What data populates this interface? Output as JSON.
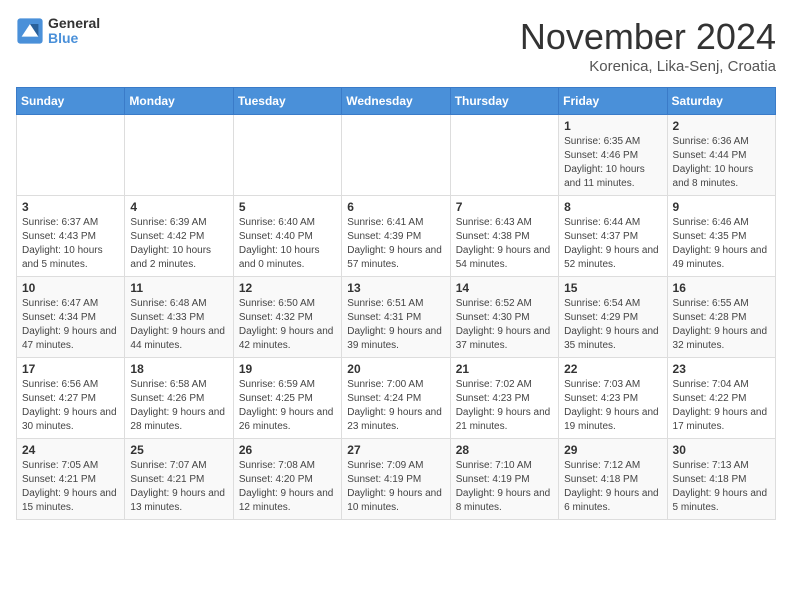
{
  "logo": {
    "text_general": "General",
    "text_blue": "Blue"
  },
  "title": "November 2024",
  "subtitle": "Korenica, Lika-Senj, Croatia",
  "days_of_week": [
    "Sunday",
    "Monday",
    "Tuesday",
    "Wednesday",
    "Thursday",
    "Friday",
    "Saturday"
  ],
  "weeks": [
    [
      {
        "day": "",
        "info": ""
      },
      {
        "day": "",
        "info": ""
      },
      {
        "day": "",
        "info": ""
      },
      {
        "day": "",
        "info": ""
      },
      {
        "day": "",
        "info": ""
      },
      {
        "day": "1",
        "info": "Sunrise: 6:35 AM\nSunset: 4:46 PM\nDaylight: 10 hours and 11 minutes."
      },
      {
        "day": "2",
        "info": "Sunrise: 6:36 AM\nSunset: 4:44 PM\nDaylight: 10 hours and 8 minutes."
      }
    ],
    [
      {
        "day": "3",
        "info": "Sunrise: 6:37 AM\nSunset: 4:43 PM\nDaylight: 10 hours and 5 minutes."
      },
      {
        "day": "4",
        "info": "Sunrise: 6:39 AM\nSunset: 4:42 PM\nDaylight: 10 hours and 2 minutes."
      },
      {
        "day": "5",
        "info": "Sunrise: 6:40 AM\nSunset: 4:40 PM\nDaylight: 10 hours and 0 minutes."
      },
      {
        "day": "6",
        "info": "Sunrise: 6:41 AM\nSunset: 4:39 PM\nDaylight: 9 hours and 57 minutes."
      },
      {
        "day": "7",
        "info": "Sunrise: 6:43 AM\nSunset: 4:38 PM\nDaylight: 9 hours and 54 minutes."
      },
      {
        "day": "8",
        "info": "Sunrise: 6:44 AM\nSunset: 4:37 PM\nDaylight: 9 hours and 52 minutes."
      },
      {
        "day": "9",
        "info": "Sunrise: 6:46 AM\nSunset: 4:35 PM\nDaylight: 9 hours and 49 minutes."
      }
    ],
    [
      {
        "day": "10",
        "info": "Sunrise: 6:47 AM\nSunset: 4:34 PM\nDaylight: 9 hours and 47 minutes."
      },
      {
        "day": "11",
        "info": "Sunrise: 6:48 AM\nSunset: 4:33 PM\nDaylight: 9 hours and 44 minutes."
      },
      {
        "day": "12",
        "info": "Sunrise: 6:50 AM\nSunset: 4:32 PM\nDaylight: 9 hours and 42 minutes."
      },
      {
        "day": "13",
        "info": "Sunrise: 6:51 AM\nSunset: 4:31 PM\nDaylight: 9 hours and 39 minutes."
      },
      {
        "day": "14",
        "info": "Sunrise: 6:52 AM\nSunset: 4:30 PM\nDaylight: 9 hours and 37 minutes."
      },
      {
        "day": "15",
        "info": "Sunrise: 6:54 AM\nSunset: 4:29 PM\nDaylight: 9 hours and 35 minutes."
      },
      {
        "day": "16",
        "info": "Sunrise: 6:55 AM\nSunset: 4:28 PM\nDaylight: 9 hours and 32 minutes."
      }
    ],
    [
      {
        "day": "17",
        "info": "Sunrise: 6:56 AM\nSunset: 4:27 PM\nDaylight: 9 hours and 30 minutes."
      },
      {
        "day": "18",
        "info": "Sunrise: 6:58 AM\nSunset: 4:26 PM\nDaylight: 9 hours and 28 minutes."
      },
      {
        "day": "19",
        "info": "Sunrise: 6:59 AM\nSunset: 4:25 PM\nDaylight: 9 hours and 26 minutes."
      },
      {
        "day": "20",
        "info": "Sunrise: 7:00 AM\nSunset: 4:24 PM\nDaylight: 9 hours and 23 minutes."
      },
      {
        "day": "21",
        "info": "Sunrise: 7:02 AM\nSunset: 4:23 PM\nDaylight: 9 hours and 21 minutes."
      },
      {
        "day": "22",
        "info": "Sunrise: 7:03 AM\nSunset: 4:23 PM\nDaylight: 9 hours and 19 minutes."
      },
      {
        "day": "23",
        "info": "Sunrise: 7:04 AM\nSunset: 4:22 PM\nDaylight: 9 hours and 17 minutes."
      }
    ],
    [
      {
        "day": "24",
        "info": "Sunrise: 7:05 AM\nSunset: 4:21 PM\nDaylight: 9 hours and 15 minutes."
      },
      {
        "day": "25",
        "info": "Sunrise: 7:07 AM\nSunset: 4:21 PM\nDaylight: 9 hours and 13 minutes."
      },
      {
        "day": "26",
        "info": "Sunrise: 7:08 AM\nSunset: 4:20 PM\nDaylight: 9 hours and 12 minutes."
      },
      {
        "day": "27",
        "info": "Sunrise: 7:09 AM\nSunset: 4:19 PM\nDaylight: 9 hours and 10 minutes."
      },
      {
        "day": "28",
        "info": "Sunrise: 7:10 AM\nSunset: 4:19 PM\nDaylight: 9 hours and 8 minutes."
      },
      {
        "day": "29",
        "info": "Sunrise: 7:12 AM\nSunset: 4:18 PM\nDaylight: 9 hours and 6 minutes."
      },
      {
        "day": "30",
        "info": "Sunrise: 7:13 AM\nSunset: 4:18 PM\nDaylight: 9 hours and 5 minutes."
      }
    ]
  ]
}
